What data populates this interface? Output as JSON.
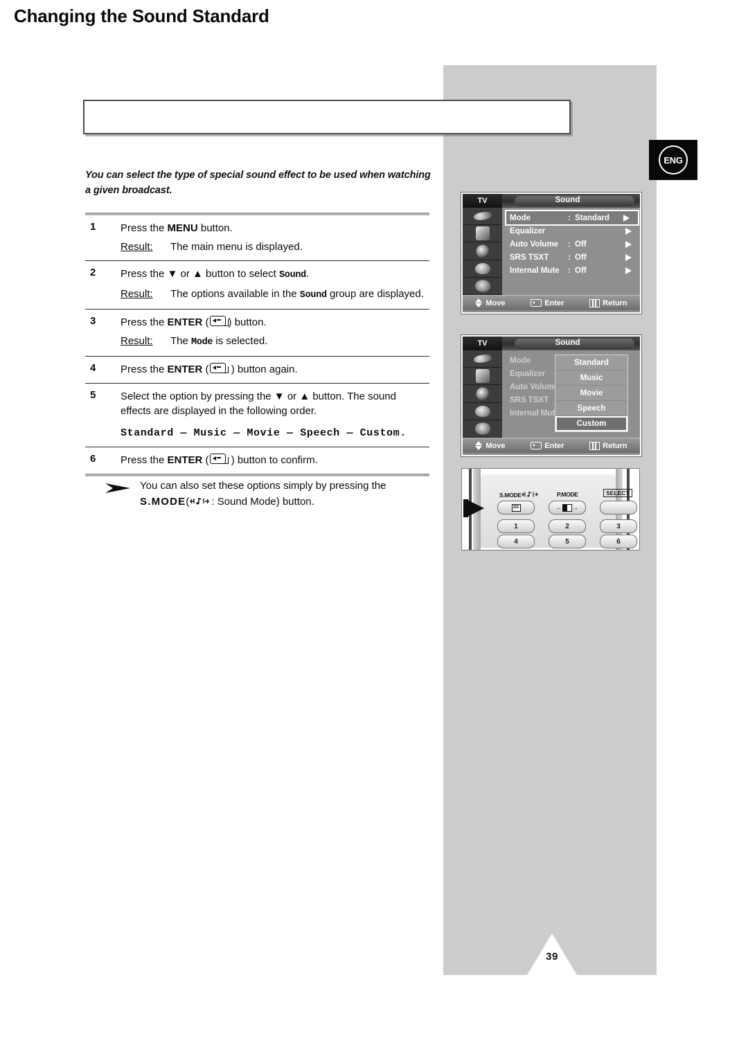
{
  "page": {
    "number": "39",
    "language_badge": "ENG",
    "title": "Changing the Sound Standard",
    "intro": "You can select the type of special sound effect to be used when watching a given broadcast."
  },
  "steps": [
    {
      "num": "1",
      "instruction_pre": "Press the ",
      "instruction_kw": "MENU",
      "instruction_post": " button.",
      "result_label": "Result:",
      "result_text": "The main menu is displayed."
    },
    {
      "num": "2",
      "instruction_pre": "Press the ▼ or ▲ button to select ",
      "instruction_kw": "Sound",
      "instruction_post": ".",
      "result_label": "Result:",
      "result_pre": "The options available in the ",
      "result_kw": "Sound",
      "result_post": " group are displayed."
    },
    {
      "num": "3",
      "instruction_pre": "Press the ",
      "instruction_kw": "ENTER",
      "instruction_post": " button.",
      "result_label": "Result:",
      "result_pre": "The ",
      "result_kw": "Mode",
      "result_post": " is selected."
    },
    {
      "num": "4",
      "instruction_pre": "Press the ",
      "instruction_kw": "ENTER",
      "instruction_post": " button again."
    },
    {
      "num": "5",
      "instruction_text": "Select the option by pressing the ▼ or ▲ button. The sound effects are displayed in the following order.",
      "order_line": "Standard — Music — Movie — Speech — Custom."
    },
    {
      "num": "6",
      "instruction_pre": "Press the ",
      "instruction_kw": "ENTER",
      "instruction_post": " button to confirm."
    }
  ],
  "tip": {
    "line1": "You can also set these options simply by pressing the",
    "keyword": "S.MODE",
    "line2_open": "(",
    "line2_close": ": Sound Mode) button."
  },
  "osd_menu_1": {
    "source_label": "TV",
    "title": "Sound",
    "rows": [
      {
        "label": "Mode",
        "colon": ":",
        "value": "Standard",
        "selected": true
      },
      {
        "label": "Equalizer",
        "colon": "",
        "value": "",
        "selected": false
      },
      {
        "label": "Auto Volume",
        "colon": ":",
        "value": "Off",
        "selected": false
      },
      {
        "label": "SRS TSXT",
        "colon": ":",
        "value": "Off",
        "selected": false
      },
      {
        "label": "Internal Mute",
        "colon": ":",
        "value": "Off",
        "selected": false
      }
    ],
    "footer": {
      "move": "Move",
      "enter": "Enter",
      "return": "Return"
    }
  },
  "osd_menu_2": {
    "source_label": "TV",
    "title": "Sound",
    "rows": [
      {
        "label": "Mode",
        "colon": ":"
      },
      {
        "label": "Equalizer",
        "colon": ""
      },
      {
        "label": "Auto Volume",
        "colon": ":"
      },
      {
        "label": "SRS TSXT",
        "colon": ":"
      },
      {
        "label": "Internal Mute",
        "colon": ":"
      }
    ],
    "popup_options": [
      {
        "label": "Standard",
        "selected": false
      },
      {
        "label": "Music",
        "selected": false
      },
      {
        "label": "Movie",
        "selected": false
      },
      {
        "label": "Speech",
        "selected": false
      },
      {
        "label": "Custom",
        "selected": true
      }
    ],
    "footer": {
      "move": "Move",
      "enter": "Enter",
      "return": "Return"
    }
  },
  "remote": {
    "labels": {
      "smode": "S.MODE",
      "pmode": "P.MODE",
      "select": "SELECT"
    },
    "keys": [
      "1",
      "2",
      "3",
      "4",
      "5",
      "6"
    ]
  },
  "colors": {
    "panel_grey": "#cccccc",
    "osd_grey": "#8f8f8f",
    "badge_black": "#080808",
    "text": "#0a0a0a"
  }
}
